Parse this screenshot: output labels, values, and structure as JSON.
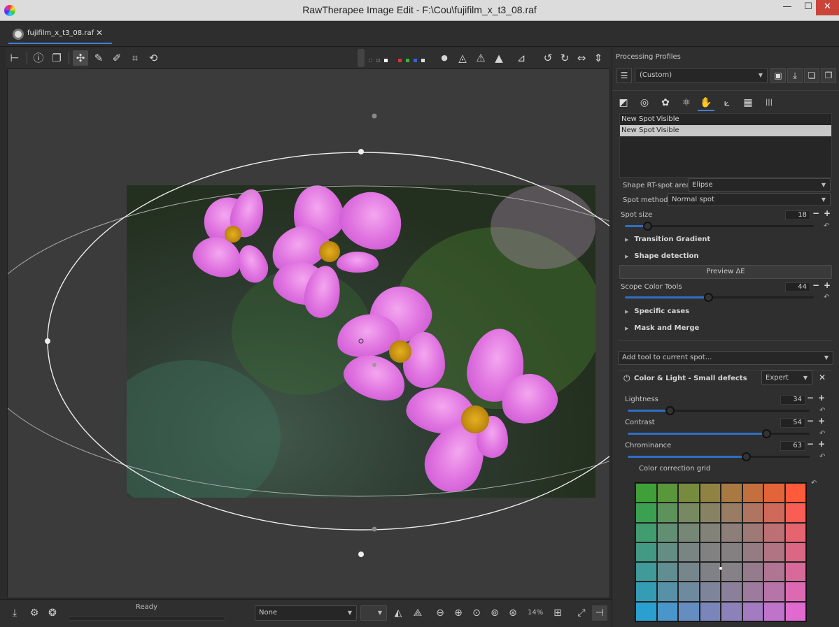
{
  "window": {
    "title": "RawTherapee Image Edit - F:\\Cou\\fujifilm_x_t3_08.raf",
    "min_glyph": "—",
    "max_glyph": "☐",
    "close_glyph": "✕"
  },
  "tabs": [
    {
      "label": "fujifilm_x_t3_08.raf",
      "close": "✕"
    }
  ],
  "status": {
    "text": "Ready",
    "profile_select": "None",
    "zoom": "14%"
  },
  "panel": {
    "processing_profiles_label": "Processing Profiles",
    "profile_value": "(Custom)",
    "spot_list": {
      "col1": "New Spot",
      "col2": "Visible",
      "rows": [
        {
          "name": "New Spot",
          "state": "Visible"
        }
      ]
    },
    "shape_label": "Shape RT-spot area:",
    "shape_value": "Elipse",
    "method_label": "Spot method:",
    "method_value": "Normal spot",
    "spot_size_label": "Spot size",
    "spot_size_value": "18",
    "transition_gradient": "Transition Gradient",
    "shape_detection": "Shape detection",
    "preview_button": "Preview ΔE",
    "scope_label": "Scope Color Tools",
    "scope_value": "44",
    "specific_cases": "Specific cases",
    "mask_and_merge": "Mask and Merge",
    "add_tool_placeholder": "Add tool to current spot...",
    "tool_title": "Color & Light - Small defects",
    "tool_mode": "Expert",
    "lightness_label": "Lightness",
    "lightness_value": "34",
    "contrast_label": "Contrast",
    "contrast_value": "54",
    "chrominance_label": "Chrominance",
    "chrominance_value": "63",
    "grid_label": "Color correction grid"
  },
  "sliders": {
    "spot_size": 0.12,
    "scope": 0.44,
    "lightness": 0.23,
    "contrast": 0.76,
    "chrominance": 0.65
  },
  "colors": {
    "accent": "#2f6fc4",
    "tab_underline": "#3e7fd8",
    "close_red": "#c9453a",
    "grid_tl": "#3fa03a",
    "grid_tr": "#ff5a3a",
    "grid_bl": "#2aa0d0",
    "grid_br": "#e06ad0"
  },
  "icons": {
    "ui_glyph_minus": "−",
    "ui_glyph_plus": "+",
    "ui_glyph_reset": "↶",
    "ui_glyph_dropdown": "▼"
  }
}
